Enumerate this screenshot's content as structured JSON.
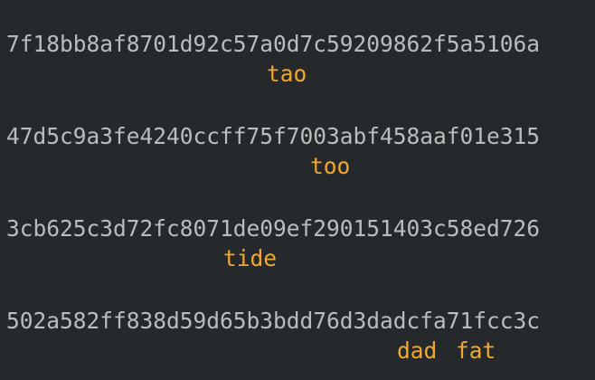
{
  "entries": [
    {
      "hash": "7f18bb8af8701d92c57a0d7c59209862f5a5106a",
      "words": [
        "tao"
      ]
    },
    {
      "hash": "47d5c9a3fe4240ccff75f7003abf458aaf01e315",
      "words": [
        "too"
      ]
    },
    {
      "hash": "3cb625c3d72fc8071de09ef290151403c58ed726",
      "words": [
        "tide"
      ]
    },
    {
      "hash": "502a582ff838d59d65b3bdd76d3dadcfa71fcc3c",
      "words": [
        "dad",
        "fat"
      ]
    }
  ],
  "colors": {
    "background": "#26292b",
    "hash_text": "#b9bdbd",
    "highlight_word": "#f2a72e"
  }
}
